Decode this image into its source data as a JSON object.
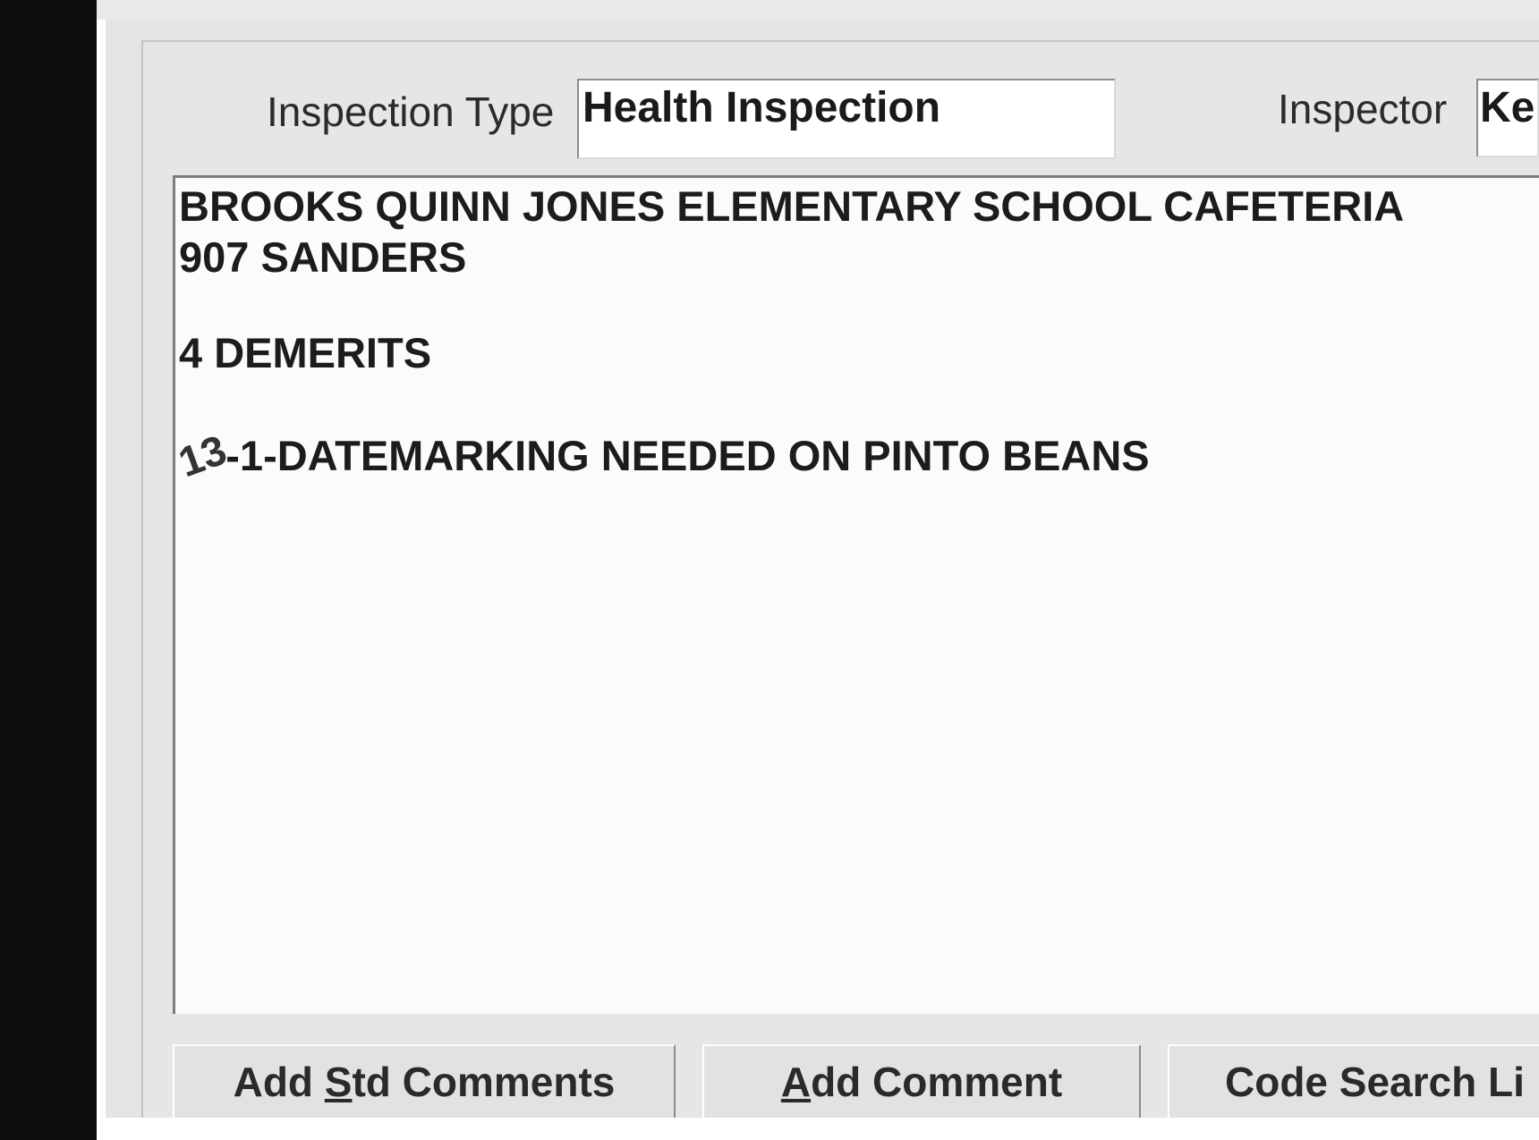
{
  "header": {
    "inspection_type_label": "Inspection Type",
    "inspection_type_value": "Health Inspection",
    "inspector_label": "Inspector",
    "inspector_value": "Ke"
  },
  "comments": {
    "lines": [
      "BROOKS QUINN JONES ELEMENTARY SCHOOL CAFETERIA",
      "907 SANDERS",
      "4 DEMERITS",
      "13",
      "-1-DATEMARKING NEEDED ON PINTO BEANS"
    ]
  },
  "buttons": {
    "add_std": {
      "pre": "Add ",
      "mnemonic": "S",
      "post": "td Comments"
    },
    "add_comment": {
      "mnemonic": "A",
      "post": "dd Comment"
    },
    "code_search": "Code Search Li"
  }
}
